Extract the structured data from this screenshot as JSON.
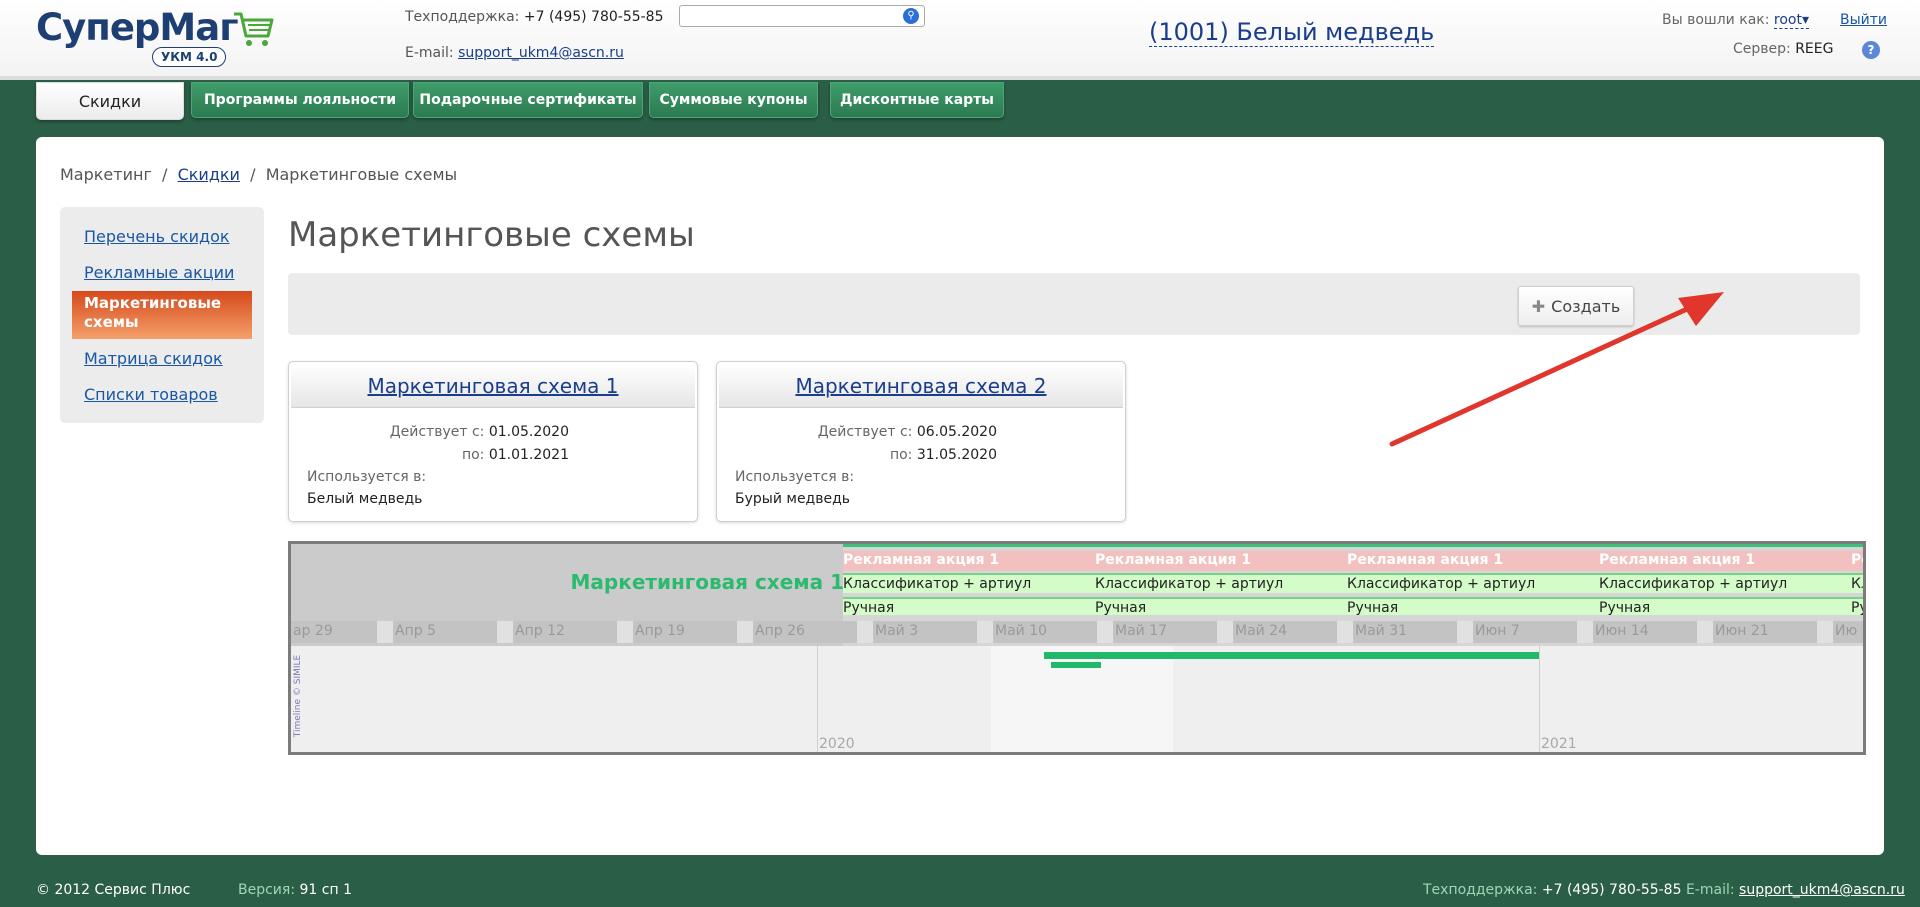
{
  "header": {
    "logo_text": "СуперМаг",
    "logo_badge": "УКМ 4.0",
    "support_label": "Техподдержка:",
    "support_phone": "+7 (495) 780-55-85",
    "email_label": "E-mail:",
    "email": "support_ukm4@ascn.ru",
    "search_value": "",
    "store": "(1001) Белый медведь",
    "user_label": "Вы вошли как:",
    "user_name": "root",
    "logout": "Выйти",
    "server_label": "Сервер:",
    "server_name": "REEG",
    "help": "?"
  },
  "tabs": [
    {
      "label": "Скидки",
      "active": true
    },
    {
      "label": "Программы лояльности"
    },
    {
      "label": "Подарочные сертификаты"
    },
    {
      "label": "Суммовые купоны"
    },
    {
      "label": "Дисконтные карты"
    }
  ],
  "breadcrumb": {
    "root": "Маркетинг",
    "link": "Скидки",
    "current": "Маркетинговые схемы",
    "sep": "/"
  },
  "sidebar": {
    "items": [
      {
        "label": "Перечень скидок"
      },
      {
        "label": "Рекламные акции"
      },
      {
        "label": "Маркетинговые схемы",
        "active": true
      },
      {
        "label": "Матрица скидок"
      },
      {
        "label": "Списки товаров"
      }
    ]
  },
  "page_title": "Маркетинговые схемы",
  "toolbar": {
    "create_label": "Создать",
    "create_icon": "plus-icon"
  },
  "cards": [
    {
      "title": "Маркетинговая схема 1",
      "from_label": "Действует с:",
      "from": "01.05.2020",
      "to_label": "по:",
      "to": "01.01.2021",
      "used_label": "Используется в:",
      "used": "Белый медведь"
    },
    {
      "title": "Маркетинговая схема 2",
      "from_label": "Действует с:",
      "from": "06.05.2020",
      "to_label": "по:",
      "to": "31.05.2020",
      "used_label": "Используется в:",
      "used": "Бурый медведь"
    }
  ],
  "timeline": {
    "title": "Маркетинговая схема 1",
    "row1_label": "Рекламная акция 1",
    "row2_label": "Классификатор + артиул",
    "row3_label": "Ручная",
    "row1_partial": "Ре",
    "row2_partial": "Кл",
    "row3_partial": "Ру",
    "dates": [
      "ар 29",
      "Апр 5",
      "Апр 12",
      "Апр 19",
      "Апр 26",
      "Май 3",
      "Май 10",
      "Май 17",
      "Май 24",
      "Май 31",
      "Июн 7",
      "Июн 14",
      "Июн 21",
      "Ию"
    ],
    "years": [
      "2020",
      "2021"
    ],
    "credit": "Timeline © SIMILE"
  },
  "colors": {
    "background": "#2b5e46",
    "tab": "#2c7a51",
    "active_sidebar": "#d54a1c",
    "timeline_title": "#2cba6e",
    "timeline_bar": "#22b86a",
    "arrow": "#e0362c"
  },
  "footer": {
    "copyright": "© 2012 Сервис Плюс",
    "version_label": "Версия:",
    "version": "91 сп 1",
    "support_label": "Техподдержка:",
    "support_phone": "+7 (495) 780-55-85",
    "email_label": "E-mail:",
    "email": "support_ukm4@ascn.ru"
  }
}
